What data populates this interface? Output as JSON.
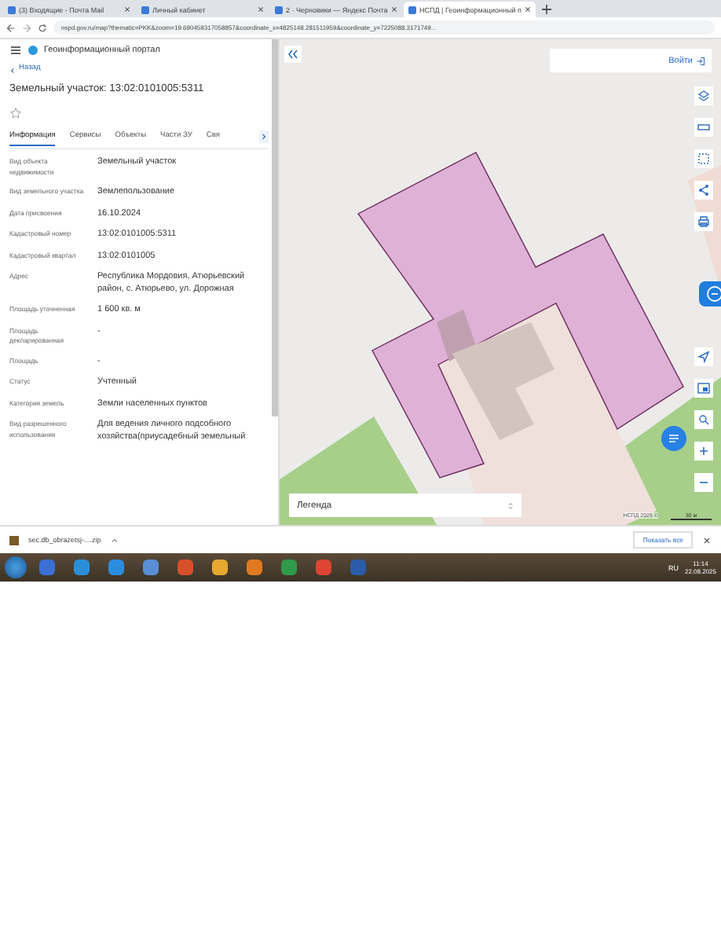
{
  "browser_tabs": [
    {
      "title": "(3) Входящие - Почта Mail",
      "selected": false
    },
    {
      "title": "Личный кабинет",
      "selected": false
    },
    {
      "title": "2 · Черновики — Яндекс Почта",
      "selected": false
    },
    {
      "title": "НСПД | Геоинформационный п",
      "selected": true
    }
  ],
  "address_bar": {
    "url": "nspd.gov.ru/map?thematic=PKK&zoom=19.690459317058857&coordinate_x=4825148.281511959&coordinate_y=7225088.3171749..."
  },
  "sidebar": {
    "portal_title": "Геоинформационный портал",
    "back": "Назад",
    "title": "Земельный участок: 13:02:0101005:5311",
    "tabs": [
      {
        "label": "Информация",
        "selected": true
      },
      {
        "label": "Сервисы",
        "selected": false
      },
      {
        "label": "Объекты",
        "selected": false
      },
      {
        "label": "Части ЗУ",
        "selected": false
      },
      {
        "label": "Свя",
        "selected": false
      }
    ],
    "properties": [
      {
        "label": "Вид объекта недвижимости",
        "value": "Земельный участок"
      },
      {
        "label": "Вид земельного участка",
        "value": "Землепользование"
      },
      {
        "label": "Дата присвоения",
        "value": "16.10.2024"
      },
      {
        "label": "Кадастровый номер",
        "value": "13:02:0101005:5311"
      },
      {
        "label": "Кадастровый квартал",
        "value": "13:02:0101005"
      },
      {
        "label": "Адрес",
        "value": "Республика Мордовия, Атюрьевский район, с. Атюрьево, ул. Дорожная"
      },
      {
        "label": "Площадь уточненная",
        "value": "1 600 кв. м"
      },
      {
        "label": "Площадь декларированная",
        "value": "-"
      },
      {
        "label": "Площадь",
        "value": "-"
      },
      {
        "label": "Статус",
        "value": "Учтенный"
      },
      {
        "label": "Категория земель",
        "value": "Земли населенных пунктов"
      },
      {
        "label": "Вид разрешенного использования",
        "value": "Для ведения личного подсобного хозяйства(приусадебный земельный"
      }
    ]
  },
  "map": {
    "login": "Войти",
    "legend": "Легенда",
    "attribution": "НСПД 2025 ©",
    "scale": "30 м"
  },
  "download_bar": {
    "file": "sec.db_obrazetsj-....zip",
    "show_all": "Показать все"
  },
  "taskbar": {
    "language": "RU",
    "time": "11:14",
    "date": "22.08.2025"
  }
}
